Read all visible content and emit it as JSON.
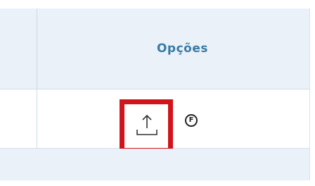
{
  "table": {
    "header": {
      "options_label": "Opções"
    },
    "row": {
      "actions": [
        {
          "icon": "upload-icon",
          "highlighted": true,
          "highlight_color": "#d1141b"
        },
        {
          "icon": "f-badge-icon",
          "label": "F"
        }
      ]
    }
  },
  "colors": {
    "header_text": "#3a7ca5",
    "header_bg": "#eaf1f8",
    "highlight": "#d1141b"
  }
}
